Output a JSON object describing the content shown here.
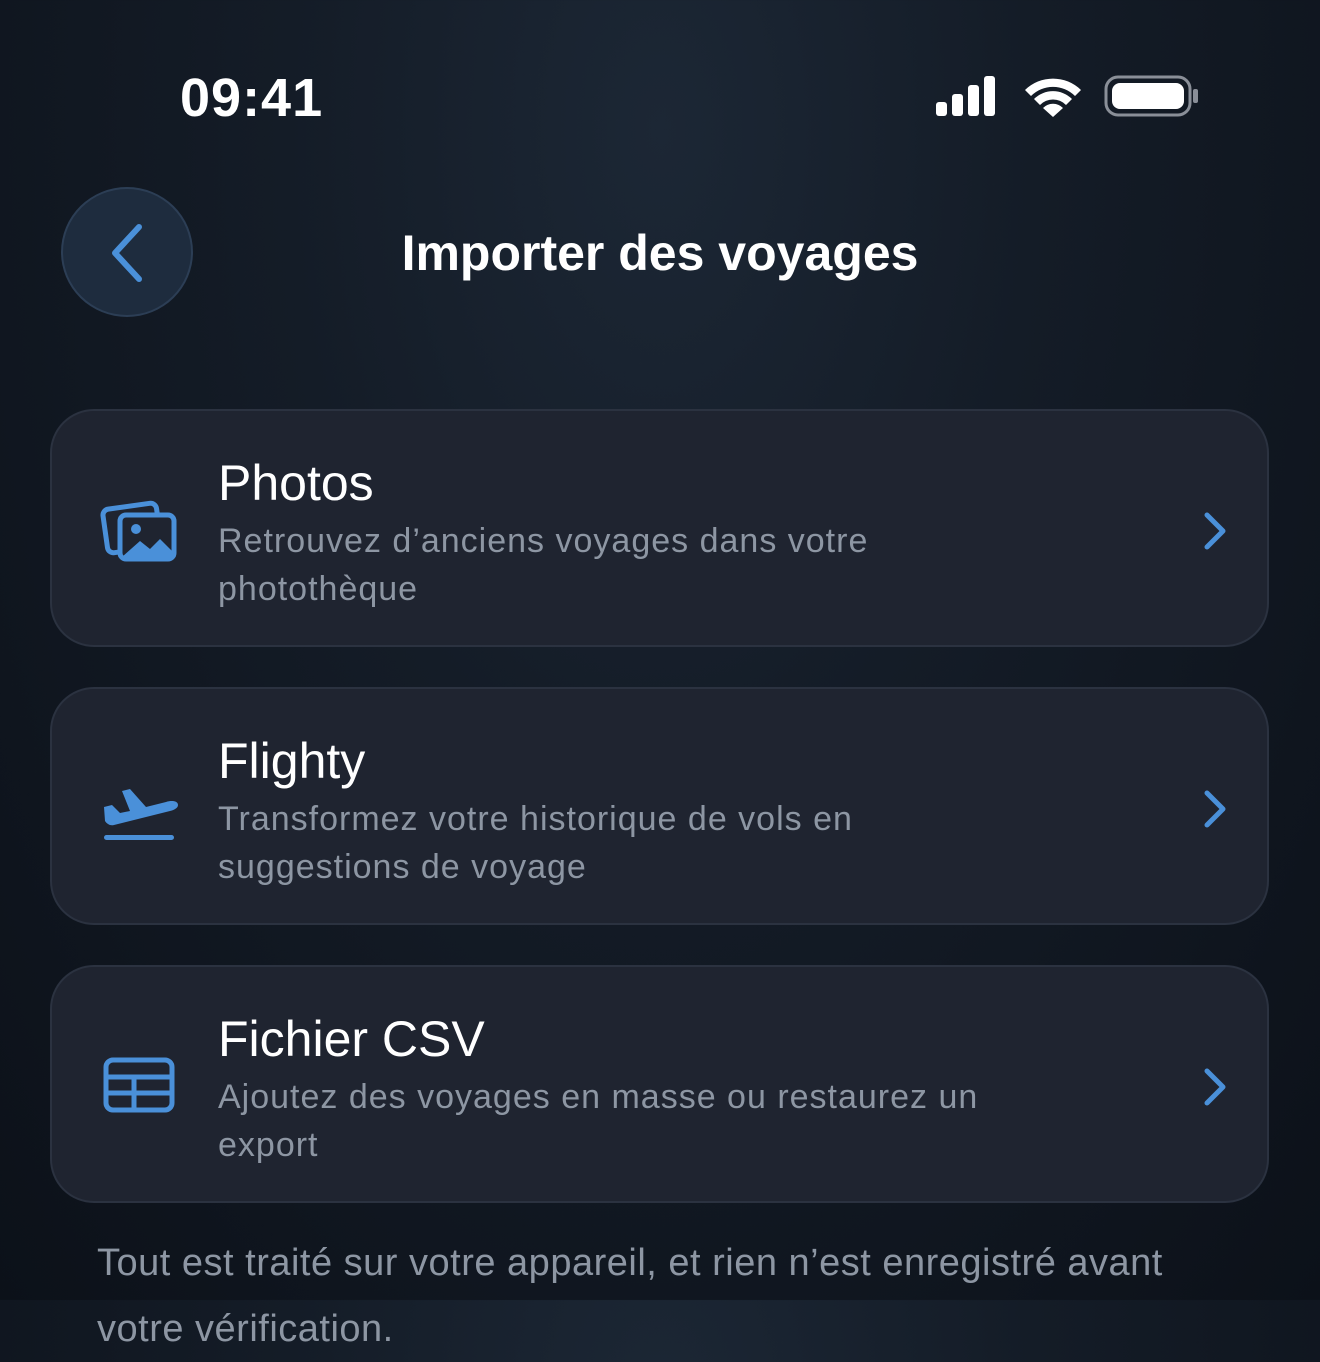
{
  "status_bar": {
    "time": "09:41",
    "icons": [
      "signal-icon",
      "wifi-icon",
      "battery-icon"
    ]
  },
  "header": {
    "title": "Importer des voyages",
    "back_icon": "chevron-left-icon"
  },
  "options": [
    {
      "icon": "photos-icon",
      "title": "Photos",
      "description": "Retrouvez d’anciens voyages dans votre photothèque"
    },
    {
      "icon": "airplane-takeoff-icon",
      "title": "Flighty",
      "description": "Transformez votre historique de vols en suggestions de voyage"
    },
    {
      "icon": "table-icon",
      "title": "Fichier CSV",
      "description": "Ajoutez des voyages en masse ou restaurez un export"
    }
  ],
  "footer": {
    "note": "Tout est traité sur votre appareil, et rien n’est enregistré avant votre vérification."
  },
  "colors": {
    "accent": "#4a90d9",
    "background": "#141c27",
    "card": "#1f2430",
    "secondary_text": "#8d96a3"
  }
}
